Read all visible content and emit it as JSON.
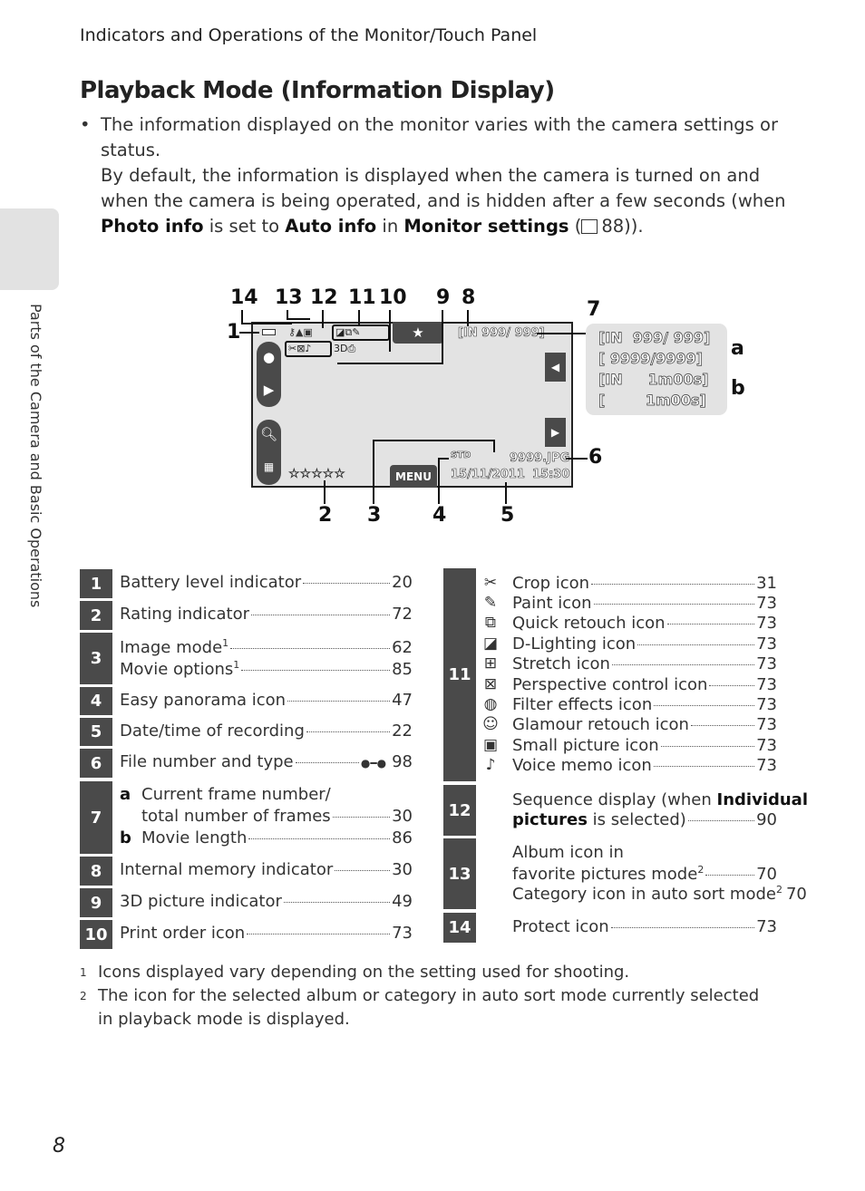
{
  "header": "Indicators and Operations of the Monitor/Touch Panel",
  "title": "Playback Mode (Information Display)",
  "body": {
    "bullet": "•",
    "p1": "The information displayed on the monitor varies with the camera settings or status.",
    "p2a": "By default, the information is displayed when the camera is turned on and when the camera is being operated, and is hidden after a few seconds (when ",
    "b1": "Photo info",
    "p2b": " is set to ",
    "b2": "Auto info",
    "p2c": " in ",
    "b3": "Monitor settings",
    "p2d": " (",
    "ref": "88",
    "p2e": "))."
  },
  "side_text": "Parts of the Camera and Basic Operations",
  "page_number": "8",
  "diagram": {
    "callouts": [
      "1",
      "2",
      "3",
      "4",
      "5",
      "6",
      "7",
      "8",
      "9",
      "10",
      "11",
      "12",
      "13",
      "14",
      "a",
      "b"
    ],
    "screen": {
      "frame": "[IN 999/ 999]",
      "file": "9999.JPG",
      "date": "15/11/2011",
      "time": "15:30",
      "menu": "MENU",
      "rating": "☆☆☆☆☆",
      "favorite_tab": "★",
      "panorama": "STD"
    },
    "panel": [
      "[IN  999/ 999]",
      "[ 9999/9999]",
      "[IN     1m00s]",
      "[        1m00s]"
    ]
  },
  "left_table": [
    {
      "n": "1",
      "lines": [
        {
          "t": "Battery level indicator",
          "p": "20"
        }
      ]
    },
    {
      "n": "2",
      "lines": [
        {
          "t": "Rating indicator",
          "p": "72"
        }
      ]
    },
    {
      "n": "3",
      "lines": [
        {
          "t": "Image mode",
          "sup": "1",
          "p": "62"
        },
        {
          "t": "Movie options",
          "sup": "1",
          "p": "85"
        }
      ]
    },
    {
      "n": "4",
      "lines": [
        {
          "t": "Easy panorama icon",
          "p": "47"
        }
      ]
    },
    {
      "n": "5",
      "lines": [
        {
          "t": "Date/time of recording",
          "p": "22"
        }
      ]
    },
    {
      "n": "6",
      "lines": [
        {
          "t": "File number and type",
          "p": "98",
          "icon": "binoculars-icon"
        }
      ]
    },
    {
      "n": "7",
      "lines": [
        {
          "k": "a",
          "t": "Current frame number/"
        },
        {
          "t": "total number of frames",
          "p": "30",
          "indent": true
        },
        {
          "k": "b",
          "t": "Movie length",
          "p": "86"
        }
      ]
    },
    {
      "n": "8",
      "lines": [
        {
          "t": "Internal memory indicator",
          "p": "30"
        }
      ]
    },
    {
      "n": "9",
      "lines": [
        {
          "t": "3D picture indicator",
          "p": "49"
        }
      ]
    },
    {
      "n": "10",
      "lines": [
        {
          "t": "Print order icon",
          "p": "73"
        }
      ]
    }
  ],
  "right_table": [
    {
      "n": "11",
      "lines": [
        {
          "icon": "crop-icon",
          "glyph": "✂",
          "t": "Crop icon",
          "p": "31"
        },
        {
          "icon": "paint-icon",
          "glyph": "✎",
          "t": "Paint icon",
          "p": "73"
        },
        {
          "icon": "quick-retouch-icon",
          "glyph": "⧉",
          "t": "Quick retouch icon",
          "p": "73"
        },
        {
          "icon": "d-lighting-icon",
          "glyph": "◪",
          "t": "D-Lighting icon",
          "p": "73"
        },
        {
          "icon": "stretch-icon",
          "glyph": "⊞",
          "t": "Stretch icon",
          "p": "73"
        },
        {
          "icon": "perspective-icon",
          "glyph": "⊠",
          "t": "Perspective control icon",
          "p": "73"
        },
        {
          "icon": "filter-effects-icon",
          "glyph": "◍",
          "t": "Filter effects icon",
          "p": "73"
        },
        {
          "icon": "glamour-retouch-icon",
          "glyph": "☺",
          "t": "Glamour retouch icon",
          "p": "73"
        },
        {
          "icon": "small-picture-icon",
          "glyph": "▣",
          "t": "Small picture icon",
          "p": "73"
        },
        {
          "icon": "voice-memo-icon",
          "glyph": "♪",
          "t": "Voice memo icon",
          "p": "73"
        }
      ]
    },
    {
      "n": "12",
      "lines": [
        {
          "t": "Sequence display (when ",
          "b": "Individual"
        },
        {
          "b": "pictures",
          "t": " is selected)",
          "p": "90"
        }
      ]
    },
    {
      "n": "13",
      "lines": [
        {
          "t": "Album icon in"
        },
        {
          "t": "favorite pictures mode",
          "sup": "2",
          "p": "70"
        },
        {
          "t": "Category icon in auto sort mode",
          "sup": "2",
          "p": "70"
        }
      ]
    },
    {
      "n": "14",
      "lines": [
        {
          "t": "Protect icon",
          "p": "73"
        }
      ]
    }
  ],
  "notes": [
    {
      "m": "1",
      "t": "Icons displayed vary depending on the setting used for shooting."
    },
    {
      "m": "2",
      "t": "The icon for the selected album or category in auto sort mode currently selected in playback mode is displayed."
    }
  ],
  "colors": {
    "number_box": "#4a4a4a",
    "screen_bg": "#e3e3e3",
    "side_tab": "#e2e2e2"
  }
}
